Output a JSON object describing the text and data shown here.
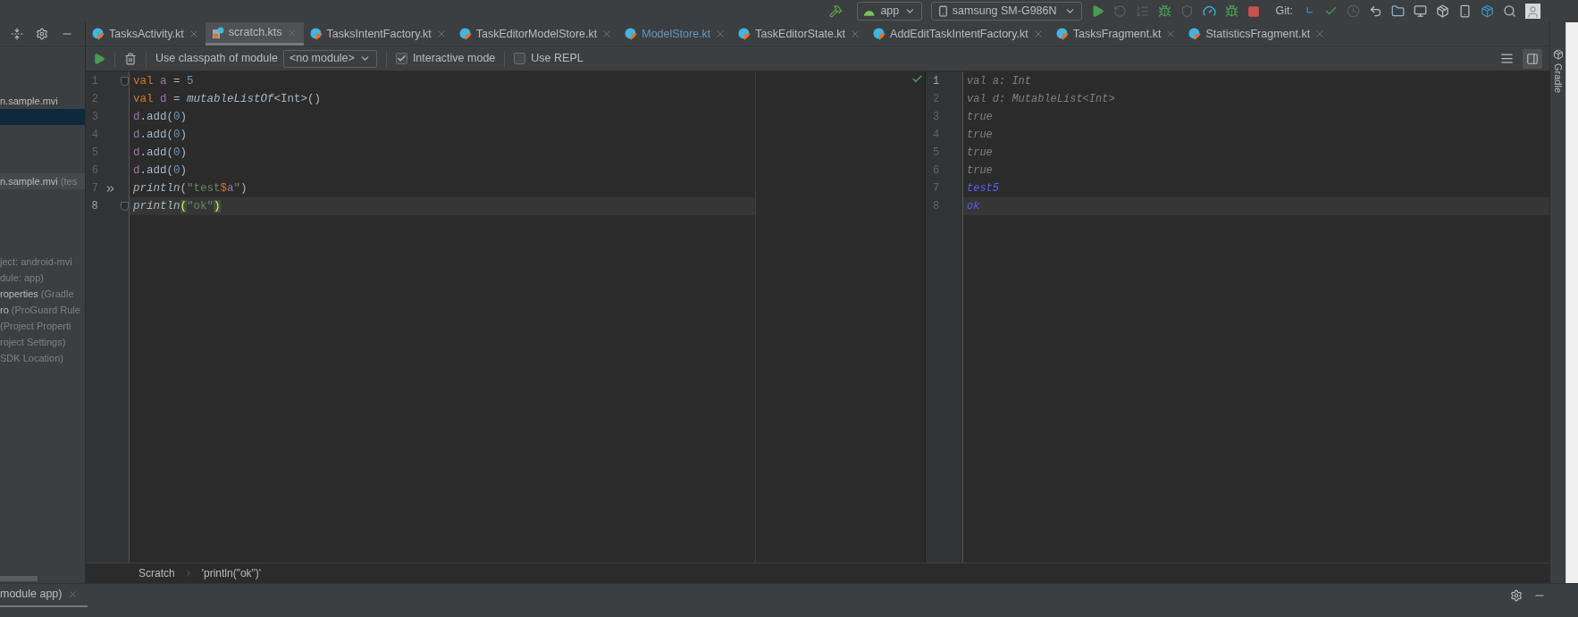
{
  "toolbar": {
    "run_config": "app",
    "device": "samsung SM-G986N",
    "git_label": "Git:"
  },
  "tabs": [
    {
      "label": "TasksActivity.kt",
      "selected": false,
      "modified": false,
      "kind": "kotlin"
    },
    {
      "label": "scratch.kts",
      "selected": true,
      "modified": false,
      "kind": "scratch"
    },
    {
      "label": "TasksIntentFactory.kt",
      "selected": false,
      "modified": false,
      "kind": "kotlin"
    },
    {
      "label": "TaskEditorModelStore.kt",
      "selected": false,
      "modified": false,
      "kind": "kotlin"
    },
    {
      "label": "ModelStore.kt",
      "selected": false,
      "modified": true,
      "kind": "kotlin"
    },
    {
      "label": "TaskEditorState.kt",
      "selected": false,
      "modified": false,
      "kind": "kotlin"
    },
    {
      "label": "AddEditTaskIntentFactory.kt",
      "selected": false,
      "modified": false,
      "kind": "kotlin"
    },
    {
      "label": "TasksFragment.kt",
      "selected": false,
      "modified": false,
      "kind": "kotlin"
    },
    {
      "label": "StatisticsFragment.kt",
      "selected": false,
      "modified": false,
      "kind": "kotlin"
    }
  ],
  "project_tree": [
    {
      "kind": "gap"
    },
    {
      "kind": "row",
      "name": "n.sample.mvi",
      "selected": false
    },
    {
      "kind": "row",
      "selected": true
    },
    {
      "kind": "gap"
    },
    {
      "kind": "gap"
    },
    {
      "kind": "gap"
    },
    {
      "kind": "scope_row",
      "name": "n.sample.mvi",
      "detail": "(tes",
      "selected": false
    },
    {
      "kind": "gap"
    },
    {
      "kind": "gap"
    },
    {
      "kind": "gap"
    },
    {
      "kind": "gap"
    },
    {
      "kind": "row",
      "detail": "ject: android-mvi",
      "selected": false
    },
    {
      "kind": "row",
      "detail": "dule: app)",
      "selected": false
    },
    {
      "kind": "row",
      "name": "roperties",
      "detail": "(Gradle",
      "selected": false
    },
    {
      "kind": "row",
      "name": "ro",
      "detail": "(ProGuard Rule",
      "selected": false
    },
    {
      "kind": "row",
      "detail": "(Project Properti",
      "selected": false
    },
    {
      "kind": "row",
      "detail": "roject Settings)",
      "selected": false
    },
    {
      "kind": "row",
      "detail": "SDK Location)",
      "selected": false
    }
  ],
  "scratch_toolbar": {
    "module_label": "Use classpath of module",
    "module_value": "<no module>",
    "options": [
      {
        "label": "Interactive mode",
        "checked": true
      },
      {
        "label": "Use REPL",
        "checked": false
      }
    ]
  },
  "code_lines": [
    {
      "number": "1",
      "current": false,
      "kind": "fold",
      "tokens": [
        {
          "kind": "keyword",
          "text": "val "
        },
        {
          "kind": "var",
          "text": "a"
        },
        {
          "kind": "plain",
          "text": " = "
        },
        {
          "kind": "number",
          "text": "5"
        }
      ]
    },
    {
      "number": "2",
      "current": false,
      "tokens": [
        {
          "kind": "keyword",
          "text": "val "
        },
        {
          "kind": "var",
          "text": "d"
        },
        {
          "kind": "plain",
          "text": " = "
        },
        {
          "kind": "call",
          "text": "mutableListOf"
        },
        {
          "kind": "plain",
          "text": "<Int>()"
        }
      ]
    },
    {
      "number": "3",
      "current": false,
      "tokens": [
        {
          "kind": "var",
          "text": "d"
        },
        {
          "kind": "plain",
          "text": ".add("
        },
        {
          "kind": "number",
          "text": "0"
        },
        {
          "kind": "plain",
          "text": ")"
        }
      ]
    },
    {
      "number": "4",
      "current": false,
      "tokens": [
        {
          "kind": "var",
          "text": "d"
        },
        {
          "kind": "plain",
          "text": ".add("
        },
        {
          "kind": "number",
          "text": "0"
        },
        {
          "kind": "plain",
          "text": ")"
        }
      ]
    },
    {
      "number": "5",
      "current": false,
      "tokens": [
        {
          "kind": "var",
          "text": "d"
        },
        {
          "kind": "plain",
          "text": ".add("
        },
        {
          "kind": "number",
          "text": "0"
        },
        {
          "kind": "plain",
          "text": ")"
        }
      ]
    },
    {
      "number": "6",
      "current": false,
      "tokens": [
        {
          "kind": "var",
          "text": "d"
        },
        {
          "kind": "plain",
          "text": ".add("
        },
        {
          "kind": "number",
          "text": "0"
        },
        {
          "kind": "plain",
          "text": ")"
        }
      ]
    },
    {
      "number": "7",
      "current": false,
      "kind": "executed",
      "tokens": [
        {
          "kind": "call",
          "text": "println"
        },
        {
          "kind": "plain",
          "text": "("
        },
        {
          "kind": "string",
          "text": "\"test"
        },
        {
          "kind": "keyword",
          "text": "$"
        },
        {
          "kind": "var",
          "text": "a"
        },
        {
          "kind": "string",
          "text": "\""
        },
        {
          "kind": "plain",
          "text": ")"
        }
      ]
    },
    {
      "number": "8",
      "current": true,
      "kind": "fold",
      "tokens": [
        {
          "kind": "call",
          "text": "println"
        },
        {
          "kind": "brace",
          "text": "("
        },
        {
          "kind": "string",
          "text": "\"ok\""
        },
        {
          "kind": "brace",
          "text": ")"
        }
      ]
    }
  ],
  "results": [
    {
      "number": "1",
      "caret": true,
      "kind": "type",
      "text": "val a: Int"
    },
    {
      "number": "2",
      "caret": false,
      "kind": "type",
      "text": "val d: MutableList<Int>"
    },
    {
      "number": "3",
      "caret": false,
      "kind": "type",
      "text": "true"
    },
    {
      "number": "4",
      "caret": false,
      "kind": "type",
      "text": "true"
    },
    {
      "number": "5",
      "caret": false,
      "kind": "type",
      "text": "true"
    },
    {
      "number": "6",
      "caret": false,
      "kind": "type",
      "text": "true"
    },
    {
      "number": "7",
      "caret": false,
      "kind": "output",
      "text": "test5"
    },
    {
      "number": "8",
      "caret": false,
      "kind": "output",
      "text": "ok"
    }
  ],
  "breadcrumb": [
    "Scratch",
    "'println(\"ok\")'"
  ],
  "bottom_tab": {
    "label": "module app)"
  },
  "right_sidebar": {
    "label": "Gradle"
  }
}
